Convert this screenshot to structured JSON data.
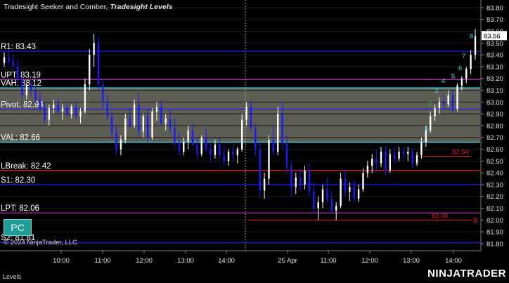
{
  "header": {
    "prefix": "Tradesight Seeker and Comber, ",
    "indicator": "Tradesight Levels"
  },
  "copyright": "© 2024 NinjaTrader, LLC",
  "panel_label": "Levels",
  "brand": "NINJATRADER",
  "pc_button": "PC",
  "colors": {
    "background": "#000000",
    "up_bar": "#ffffff",
    "down_bar": "#1a1aff",
    "blue_level": "#1c1cd8",
    "magenta_level": "#b030b0",
    "cyan_level": "#40d8e8",
    "red_level": "#e02020",
    "value_area": "#5e5e55",
    "count_cyan": "#3fd0e0",
    "count_green": "#2fae3f"
  },
  "chart_data": {
    "type": "ohlc",
    "ylim": [
      81.75,
      83.7
    ],
    "y_ticks": [
      "83.80",
      "83.70",
      "83.60",
      "83.50",
      "83.40",
      "83.30",
      "83.20",
      "83.10",
      "83.00",
      "82.90",
      "82.80",
      "82.70",
      "82.60",
      "82.50",
      "82.40",
      "82.30",
      "82.20",
      "82.10",
      "82.00",
      "81.90",
      "81.80"
    ],
    "last_price": "83.56",
    "x_ticks": [
      "10:00",
      "11:00",
      "12:00",
      "13:00",
      "14:00",
      "25 Apr",
      "11:00",
      "12:00",
      "13:00",
      "14:00"
    ],
    "levels": [
      {
        "label": "R1: 83.43",
        "value": 83.43,
        "color": "blue"
      },
      {
        "label": "UPT: 83.19",
        "value": 83.19,
        "color": "magenta"
      },
      {
        "label": "VAH: 83.12",
        "value": 83.12,
        "color": "cyan"
      },
      {
        "label": "Pivot: 82.94",
        "value": 82.94,
        "color": "blue"
      },
      {
        "label": "VAL: 82.66",
        "value": 82.66,
        "color": "cyan"
      },
      {
        "label": "LBreak: 82.42",
        "value": 82.42,
        "color": "red"
      },
      {
        "label": "S1: 82.30",
        "value": 82.3,
        "color": "blue"
      },
      {
        "label": "LPT: 82.06",
        "value": 82.06,
        "color": "magenta"
      },
      {
        "label": "S2: 81.81",
        "value": 81.81,
        "color": "blue"
      }
    ],
    "value_area": [
      82.66,
      83.12
    ],
    "price_marks": [
      {
        "label": "82.54",
        "value": 82.54
      },
      {
        "label": "82.00",
        "value": 82.0
      }
    ],
    "red_count": "8",
    "seq_counts": [
      {
        "label": "1",
        "value": 82.76,
        "color": "cyan"
      },
      {
        "label": "2",
        "value": 82.97,
        "color": "green"
      },
      {
        "label": "3",
        "value": 83.08,
        "color": "cyan"
      },
      {
        "label": "4",
        "value": 83.16,
        "color": "cyan"
      },
      {
        "label": "5",
        "value": 83.2,
        "color": "cyan"
      },
      {
        "label": "6",
        "value": 83.27,
        "color": "cyan"
      },
      {
        "label": "7",
        "value": 83.37,
        "color": "cyan"
      },
      {
        "label": "8",
        "value": 83.54,
        "color": "cyan"
      }
    ],
    "bars": [
      [
        83.33,
        83.42,
        83.3,
        83.38
      ],
      [
        83.38,
        83.45,
        83.32,
        83.35
      ],
      [
        83.35,
        83.4,
        83.28,
        83.3
      ],
      [
        83.3,
        83.36,
        83.16,
        83.2
      ],
      [
        83.2,
        83.24,
        83.02,
        83.06
      ],
      [
        83.06,
        83.18,
        83.02,
        83.15
      ],
      [
        83.15,
        83.18,
        83.05,
        83.1
      ],
      [
        83.1,
        83.14,
        82.99,
        83.02
      ],
      [
        83.02,
        83.08,
        82.92,
        82.95
      ],
      [
        82.95,
        83.0,
        82.82,
        82.85
      ],
      [
        82.85,
        82.98,
        82.8,
        82.95
      ],
      [
        82.95,
        83.02,
        82.9,
        82.98
      ],
      [
        82.98,
        83.04,
        82.9,
        82.92
      ],
      [
        82.92,
        82.98,
        82.85,
        82.95
      ],
      [
        82.95,
        83.0,
        82.88,
        82.9
      ],
      [
        82.9,
        82.98,
        82.86,
        82.96
      ],
      [
        82.96,
        83.0,
        82.86,
        82.88
      ],
      [
        82.88,
        82.95,
        82.82,
        82.92
      ],
      [
        82.92,
        83.2,
        82.9,
        83.15
      ],
      [
        83.15,
        83.45,
        83.1,
        83.4
      ],
      [
        83.4,
        83.58,
        83.3,
        83.5
      ],
      [
        83.5,
        83.55,
        83.1,
        83.15
      ],
      [
        83.15,
        83.2,
        82.95,
        83.0
      ],
      [
        83.0,
        83.06,
        82.85,
        82.88
      ],
      [
        82.88,
        82.92,
        82.7,
        82.74
      ],
      [
        82.74,
        82.8,
        82.55,
        82.6
      ],
      [
        82.6,
        82.72,
        82.55,
        82.68
      ],
      [
        82.68,
        82.9,
        82.65,
        82.86
      ],
      [
        82.86,
        82.95,
        82.78,
        82.8
      ],
      [
        82.8,
        83.02,
        82.78,
        82.98
      ],
      [
        82.98,
        83.08,
        82.7,
        82.75
      ],
      [
        82.75,
        82.9,
        82.7,
        82.88
      ],
      [
        82.88,
        82.94,
        82.66,
        82.7
      ],
      [
        82.7,
        82.95,
        82.68,
        82.92
      ],
      [
        82.92,
        83.0,
        82.84,
        82.96
      ],
      [
        82.96,
        83.02,
        82.8,
        82.82
      ],
      [
        82.82,
        82.9,
        82.76,
        82.86
      ],
      [
        82.86,
        82.94,
        82.74,
        82.78
      ],
      [
        82.78,
        82.86,
        82.62,
        82.66
      ],
      [
        82.66,
        82.74,
        82.55,
        82.58
      ],
      [
        82.58,
        82.7,
        82.55,
        82.66
      ],
      [
        82.66,
        82.8,
        82.6,
        82.76
      ],
      [
        82.76,
        82.82,
        82.62,
        82.64
      ],
      [
        82.64,
        82.7,
        82.52,
        82.56
      ],
      [
        82.56,
        82.72,
        82.54,
        82.7
      ],
      [
        82.7,
        82.78,
        82.58,
        82.6
      ],
      [
        82.6,
        82.66,
        82.5,
        82.55
      ],
      [
        82.55,
        82.68,
        82.52,
        82.64
      ],
      [
        82.64,
        82.7,
        82.52,
        82.55
      ],
      [
        82.55,
        82.62,
        82.46,
        82.5
      ],
      [
        82.5,
        82.6,
        82.46,
        82.58
      ],
      [
        82.58,
        82.64,
        82.5,
        82.55
      ],
      [
        82.55,
        82.62,
        82.48,
        82.6
      ],
      [
        82.6,
        82.9,
        82.58,
        82.85
      ],
      [
        82.85,
        83.0,
        82.8,
        82.96
      ],
      [
        82.96,
        83.02,
        82.75,
        82.78
      ],
      [
        82.78,
        82.82,
        82.55,
        82.6
      ],
      [
        82.6,
        82.66,
        82.2,
        82.25
      ],
      [
        82.25,
        82.4,
        82.18,
        82.35
      ],
      [
        82.35,
        82.72,
        82.3,
        82.68
      ],
      [
        82.68,
        82.8,
        82.55,
        82.58
      ],
      [
        82.58,
        82.96,
        82.55,
        82.9
      ],
      [
        82.9,
        83.0,
        82.6,
        82.65
      ],
      [
        82.65,
        82.72,
        82.4,
        82.45
      ],
      [
        82.45,
        82.5,
        82.2,
        82.28
      ],
      [
        82.28,
        82.4,
        82.22,
        82.36
      ],
      [
        82.36,
        82.44,
        82.25,
        82.3
      ],
      [
        82.3,
        82.46,
        82.26,
        82.42
      ],
      [
        82.42,
        82.48,
        82.2,
        82.24
      ],
      [
        82.24,
        82.32,
        82.05,
        82.1
      ],
      [
        82.1,
        82.2,
        82.0,
        82.15
      ],
      [
        82.15,
        82.3,
        82.1,
        82.26
      ],
      [
        82.26,
        82.36,
        82.14,
        82.18
      ],
      [
        82.18,
        82.24,
        82.05,
        82.08
      ],
      [
        82.08,
        82.15,
        82.0,
        82.12
      ],
      [
        82.12,
        82.4,
        82.1,
        82.35
      ],
      [
        82.35,
        82.42,
        82.2,
        82.24
      ],
      [
        82.24,
        82.32,
        82.16,
        82.28
      ],
      [
        82.28,
        82.34,
        82.14,
        82.18
      ],
      [
        82.18,
        82.3,
        82.15,
        82.26
      ],
      [
        82.26,
        82.44,
        82.24,
        82.4
      ],
      [
        82.4,
        82.5,
        82.36,
        82.46
      ],
      [
        82.46,
        82.56,
        82.4,
        82.52
      ],
      [
        82.52,
        82.6,
        82.42,
        82.48
      ],
      [
        82.48,
        82.62,
        82.45,
        82.58
      ],
      [
        82.58,
        82.63,
        82.38,
        82.42
      ],
      [
        82.42,
        82.6,
        82.4,
        82.56
      ],
      [
        82.56,
        82.62,
        82.48,
        82.52
      ],
      [
        82.52,
        82.62,
        82.5,
        82.58
      ],
      [
        82.58,
        82.62,
        82.52,
        82.56
      ],
      [
        82.56,
        82.62,
        82.5,
        82.58
      ],
      [
        82.58,
        82.61,
        82.44,
        82.48
      ],
      [
        82.48,
        82.58,
        82.46,
        82.55
      ],
      [
        82.55,
        82.7,
        82.52,
        82.66
      ],
      [
        82.66,
        82.8,
        82.62,
        82.76
      ],
      [
        82.76,
        82.92,
        82.74,
        82.88
      ],
      [
        82.88,
        82.98,
        82.84,
        82.95
      ],
      [
        82.95,
        83.04,
        82.9,
        83.0
      ],
      [
        83.0,
        83.06,
        82.94,
        82.98
      ],
      [
        82.98,
        83.1,
        82.96,
        83.06
      ],
      [
        83.06,
        83.1,
        82.9,
        82.94
      ],
      [
        82.94,
        83.16,
        82.92,
        83.14
      ],
      [
        83.14,
        83.22,
        83.1,
        83.2
      ],
      [
        83.2,
        83.3,
        83.16,
        83.28
      ],
      [
        83.28,
        83.44,
        83.24,
        83.4
      ],
      [
        83.4,
        83.62,
        83.36,
        83.56
      ]
    ]
  }
}
